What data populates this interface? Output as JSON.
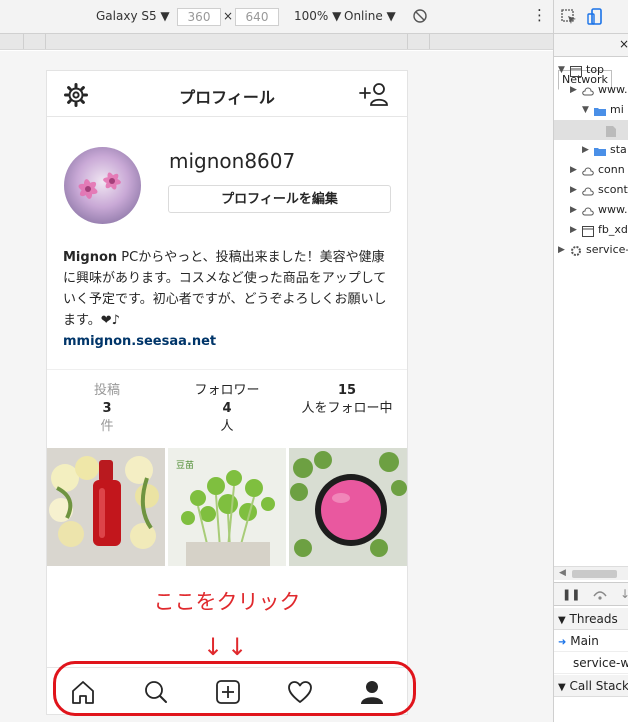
{
  "device_toolbar": {
    "device": "Galaxy S5",
    "width": "360",
    "times": "×",
    "height": "640",
    "zoom": "100%",
    "network": "Online"
  },
  "header": {
    "title": "プロフィール"
  },
  "profile": {
    "username": "mignon8607",
    "edit_label": "プロフィールを編集",
    "bio_name": "Mignon",
    "bio_text": " PCからやっと、投稿出来ました！美容や健康に興味があります。コスメなど使った商品をアップしていく予定です。初心者ですが、どうぞよろしくお願いします。❤♪",
    "link": "mmignon.seesaa.net"
  },
  "stats": [
    {
      "label": "投稿",
      "value": "3",
      "unit": "件"
    },
    {
      "label": "フォロワー",
      "value": "4",
      "unit": "人"
    },
    {
      "value": "15",
      "unit": "人をフォロー中"
    }
  ],
  "thumbs": [
    {
      "caption": ""
    },
    {
      "caption": "豆苗"
    },
    {
      "caption": ""
    }
  ],
  "annotation": {
    "text": "ここをクリック",
    "arrows": "↓↓"
  },
  "bottom_nav": [
    "home-icon",
    "search-icon",
    "add-post-icon",
    "heart-icon",
    "profile-icon"
  ],
  "devtools": {
    "tab": "Network",
    "tree": [
      {
        "label": "top",
        "indent": 0
      },
      {
        "label": "www.",
        "indent": 1
      },
      {
        "label": "mi",
        "indent": 2
      },
      {
        "label": "",
        "indent": 3
      },
      {
        "label": "sta",
        "indent": 2
      },
      {
        "label": "conn",
        "indent": 1
      },
      {
        "label": "scont",
        "indent": 1
      },
      {
        "label": "www.",
        "indent": 1
      },
      {
        "label": "fb_xd",
        "indent": 1
      },
      {
        "label": "service-",
        "indent": 0
      }
    ],
    "threads_label": "Threads",
    "main_label": "Main",
    "service_label": "service-wo",
    "callstack_label": "Call Stack"
  },
  "colors": {
    "annotation": "#e0292d",
    "link": "#003569",
    "highlight_box": "#e0141b"
  }
}
